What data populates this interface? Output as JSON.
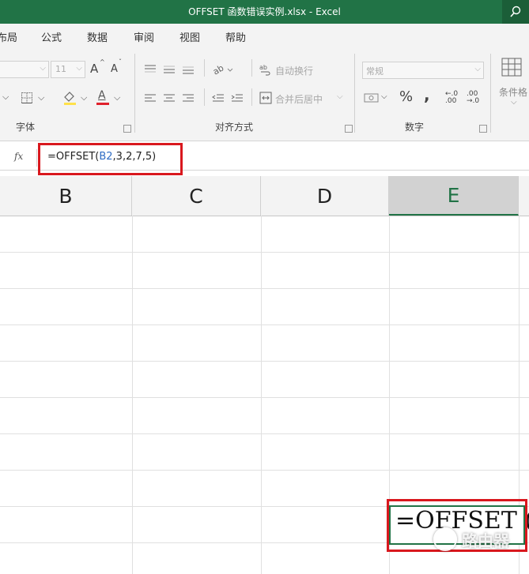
{
  "window": {
    "title": "OFFSET 函数错误实例.xlsx  -  Excel"
  },
  "menu": {
    "tabs": [
      "布局",
      "公式",
      "数据",
      "审阅",
      "视图",
      "帮助"
    ]
  },
  "ribbon": {
    "font_group": {
      "label": "字体",
      "size_value": "11",
      "grow_font": "A",
      "shrink_font": "A",
      "font_color_glyph": "A"
    },
    "alignment_group": {
      "label": "对齐方式",
      "wrap_text": "自动换行",
      "merge_center": "合并后居中"
    },
    "number_group": {
      "label": "数字",
      "format_value": "常规",
      "percent": "%",
      "comma": ",",
      "increase_decimal": "←.0 .00",
      "decrease_decimal": ".00 →.0"
    },
    "styles_group": {
      "conditional_format": "条件格"
    }
  },
  "formula_bar": {
    "fx_label": "fx",
    "formula_prefix": "=OFFSET(",
    "formula_ref": "B2",
    "formula_suffix": ",3,2,7,5)"
  },
  "columns": [
    {
      "letter": "B",
      "selected": false
    },
    {
      "letter": "C",
      "selected": false
    },
    {
      "letter": "D",
      "selected": false
    },
    {
      "letter": "E",
      "selected": true
    }
  ],
  "active_cell": {
    "entry_text": "=OFFSET ("
  },
  "watermark": {
    "text": "路由器"
  },
  "colors": {
    "excel_green": "#217346",
    "highlight_red": "#d9181e",
    "ref_blue": "#2f6cc4"
  }
}
